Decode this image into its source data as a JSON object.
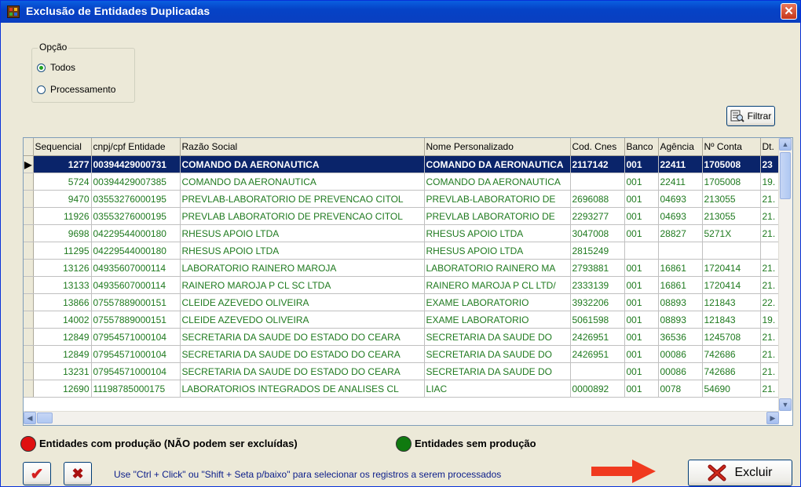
{
  "window": {
    "title": "Exclusão de Entidades Duplicadas",
    "close_label": "✕"
  },
  "option_group": {
    "legend": "Opção",
    "options": [
      {
        "label": "Todos",
        "checked": true
      },
      {
        "label": "Processamento",
        "checked": false
      }
    ]
  },
  "filter_button": {
    "label": "Filtrar",
    "icon": "filter-icon"
  },
  "grid": {
    "columns": [
      "Sequencial",
      "cnpj/cpf Entidade",
      "Razão Social",
      "Nome Personalizado",
      "Cod. Cnes",
      "Banco",
      "Agência",
      "Nº Conta",
      "Dt."
    ],
    "rows": [
      [
        "1277",
        "00394429000731",
        "COMANDO DA AERONAUTICA",
        "COMANDO DA AERONAUTICA",
        "2117142",
        "001",
        "22411",
        "1705008",
        "23"
      ],
      [
        "5724",
        "00394429007385",
        "COMANDO DA AERONAUTICA",
        "COMANDO DA AERONAUTICA",
        "",
        "001",
        "22411",
        "1705008",
        "19."
      ],
      [
        "9470",
        "03553276000195",
        "PREVLAB-LABORATORIO DE PREVENCAO CITOL",
        "PREVLAB-LABORATORIO DE",
        "2696088",
        "001",
        "04693",
        "213055",
        "21."
      ],
      [
        "11926",
        "03553276000195",
        "PREVLAB LABORATORIO DE PREVENCAO CITOL",
        "PREVLAB LABORATORIO DE",
        "2293277",
        "001",
        "04693",
        "213055",
        "21."
      ],
      [
        "9698",
        "04229544000180",
        "RHESUS APOIO LTDA",
        "RHESUS APOIO LTDA",
        "3047008",
        "001",
        "28827",
        "5271X",
        "21."
      ],
      [
        "11295",
        "04229544000180",
        "RHESUS APOIO LTDA",
        "RHESUS APOIO LTDA",
        "2815249",
        "",
        "",
        "",
        ""
      ],
      [
        "13126",
        "04935607000114",
        "LABORATORIO RAINERO MAROJA",
        "LABORATORIO RAINERO MA",
        "2793881",
        "001",
        "16861",
        "1720414",
        "21."
      ],
      [
        "13133",
        "04935607000114",
        "RAINERO MAROJA P CL SC LTDA",
        "RAINERO MAROJA P CL LTD/",
        "2333139",
        "001",
        "16861",
        "1720414",
        "21."
      ],
      [
        "13866",
        "07557889000151",
        "CLEIDE AZEVEDO OLIVEIRA",
        "EXAME LABORATORIO",
        "3932206",
        "001",
        "08893",
        "121843",
        "22."
      ],
      [
        "14002",
        "07557889000151",
        "CLEIDE AZEVEDO OLIVEIRA",
        "EXAME LABORATORIO",
        "5061598",
        "001",
        "08893",
        "121843",
        "19."
      ],
      [
        "12849",
        "07954571000104",
        "SECRETARIA DA SAUDE DO ESTADO DO CEARA",
        "SECRETARIA DA SAUDE DO",
        "2426951",
        "001",
        "36536",
        "1245708",
        "21."
      ],
      [
        "12849",
        "07954571000104",
        "SECRETARIA DA SAUDE DO ESTADO DO CEARA",
        "SECRETARIA DA SAUDE DO",
        "2426951",
        "001",
        "00086",
        "742686",
        "21."
      ],
      [
        "13231",
        "07954571000104",
        "SECRETARIA DA SAUDE DO ESTADO DO CEARA",
        "SECRETARIA DA SAUDE DO",
        "",
        "001",
        "00086",
        "742686",
        "21."
      ],
      [
        "12690",
        "11198785000175",
        "LABORATORIOS INTEGRADOS DE ANALISES CL",
        "LIAC",
        "0000892",
        "001",
        "0078",
        "54690",
        "21."
      ]
    ],
    "selected_row": 0,
    "row_indicator": "▶"
  },
  "legend": {
    "with_production": {
      "label": "Entidades com produção (NÃO podem ser excluídas)",
      "color": "#E01010"
    },
    "without_production": {
      "label": "Entidades sem produção",
      "color": "#0F7A0F"
    }
  },
  "footer": {
    "check_label": "✔",
    "uncheck_label": "✖",
    "hint": "Use \"Ctrl + Click\" ou \"Shift + Seta p/baixo\" para selecionar os registros a serem processados",
    "delete_label": "Excluir"
  }
}
